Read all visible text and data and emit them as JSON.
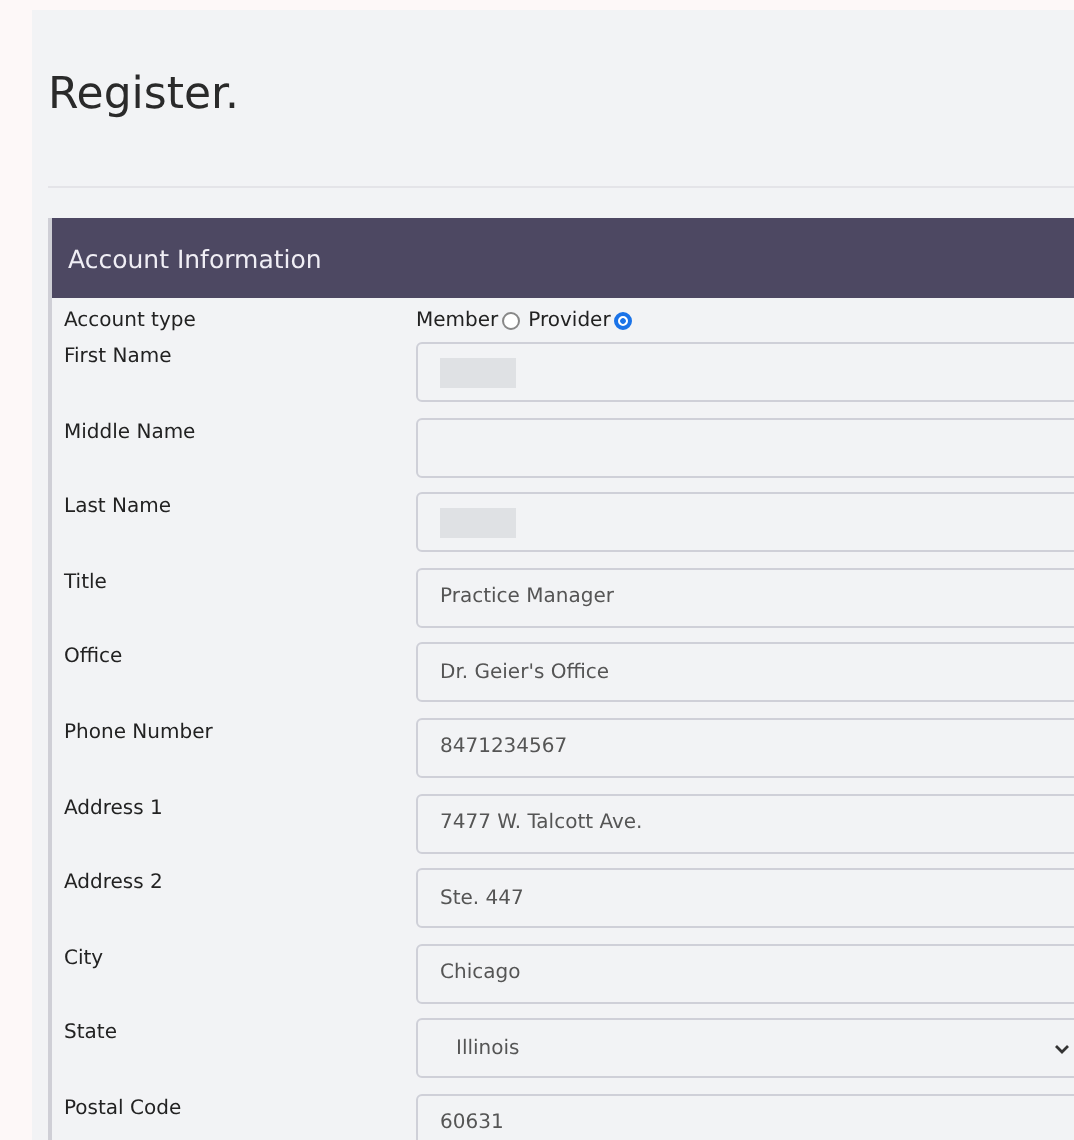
{
  "page_title": "Register.",
  "panel": {
    "title": "Account Information",
    "account_type": {
      "label": "Account type",
      "options": [
        {
          "label": "Member",
          "selected": false
        },
        {
          "label": "Provider",
          "selected": true
        }
      ]
    },
    "fields": [
      {
        "label": "First Name",
        "kind": "redacted"
      },
      {
        "label": "Middle Name",
        "kind": "text"
      },
      {
        "label": "Last Name",
        "kind": "redacted"
      },
      {
        "label": "Title",
        "kind": "text",
        "value": "Practice Manager"
      },
      {
        "label": "Office",
        "kind": "text",
        "value": "Dr. Geier's Office"
      },
      {
        "label": "Phone Number",
        "kind": "text",
        "value": "8471234567"
      },
      {
        "label": "Address 1",
        "kind": "text",
        "value": "7477 W. Talcott Ave."
      },
      {
        "label": "Address 2",
        "kind": "text",
        "value": "Ste. 447"
      },
      {
        "label": "City",
        "kind": "text",
        "value": "Chicago"
      },
      {
        "label": "State",
        "kind": "select",
        "value": "Illinois"
      },
      {
        "label": "Postal Code",
        "kind": "text",
        "value": "60631"
      }
    ]
  }
}
